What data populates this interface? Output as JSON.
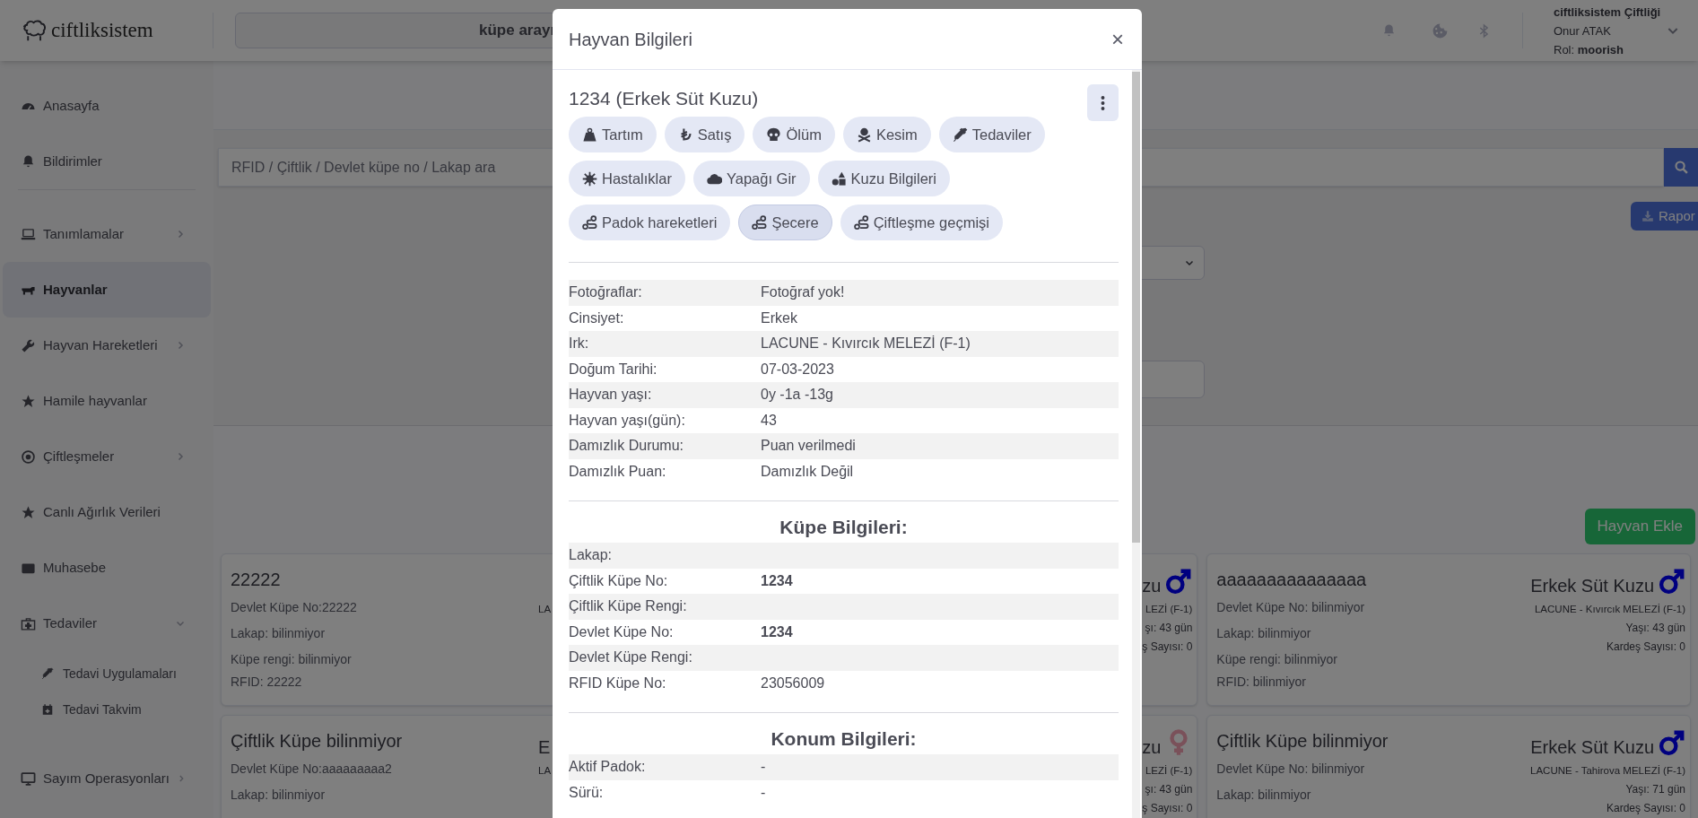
{
  "topbar": {
    "logo": "ciftliksistem",
    "search_button": "küpe arayı",
    "farm": "ciftliksistem Çiftliği",
    "user": "Onur ATAK",
    "role_label": "Rol:",
    "role": "moorish"
  },
  "sidebar": {
    "items": [
      {
        "label": "Anasayfa",
        "kind": "link",
        "selected": false
      },
      {
        "label": "Bildirimler",
        "kind": "link",
        "selected": false
      },
      {
        "label": "Tanımlamalar",
        "kind": "group",
        "selected": false,
        "expanded": false
      },
      {
        "label": "Hayvanlar",
        "kind": "link",
        "selected": true
      },
      {
        "label": "Hayvan Hareketleri",
        "kind": "group",
        "selected": false,
        "expanded": false
      },
      {
        "label": "Hamile hayvanlar",
        "kind": "link",
        "selected": false
      },
      {
        "label": "Çiftleşmeler",
        "kind": "group",
        "selected": false,
        "expanded": false
      },
      {
        "label": "Canlı Ağırlık Verileri",
        "kind": "link",
        "selected": false
      },
      {
        "label": "Muhasebe",
        "kind": "link",
        "selected": false
      },
      {
        "label": "Tedaviler",
        "kind": "group",
        "selected": false,
        "expanded": true,
        "children": [
          {
            "label": "Tedavi Uygulamaları",
            "selected": false
          },
          {
            "label": "Tedavi Takvim",
            "selected": false
          }
        ]
      },
      {
        "label": "Sayım Operasyonları",
        "kind": "group",
        "selected": false,
        "expanded": false
      }
    ]
  },
  "main": {
    "search": {
      "placeholder": "RFID / Çiftlik / Devlet küpe no / Lakap ara"
    },
    "report_button": "Rapor",
    "add_button": "Hayvan Ekle",
    "cards": [
      {
        "title": "22222",
        "details": [
          "Devlet Küpe No:22222",
          "Lakap: bilinmiyor",
          "Küpe rengi: bilinmiyor",
          "RFID: 22222"
        ],
        "breed": "LA"
      },
      {
        "type": "zu",
        "kind": "male",
        "breed": "LEZİ (F-1)",
        "age": "şı: 43 gün",
        "siblings": "ş Sayısı: 0"
      },
      {
        "title": "aaaaaaaaaaaaaaa",
        "details": [
          "Devlet Küpe No: bilinmiyor",
          "Lakap: bilinmiyor",
          "Küpe rengi: bilinmiyor",
          "RFID: bilinmiyor"
        ],
        "type": "Erkek Süt Kuzu",
        "kind": "male",
        "breed": "LACUNE - Kıvırcık MELEZİ (F-1)",
        "age": "Yaşı: 43 gün",
        "siblings": "Kardeş Sayısı: 0"
      },
      {
        "title": "Çiftlik Küpe bilinmiyor",
        "details": [
          "Devlet Küpe No:aaaaaaaaa2",
          "Lakap: bilinmiyor"
        ],
        "type": "E",
        "breed": "LA"
      },
      {
        "type": "zu",
        "kind": "female",
        "breed": "LEZİ (F-1)",
        "age": "şı: 43 gün",
        "siblings": "ş Sayısı: 0"
      },
      {
        "title": "Çiftlik Küpe bilinmiyor",
        "details": [
          "Devlet Küpe No: bilinmiyor",
          "Lakap: bilinmiyor"
        ],
        "type": "Erkek Süt Kuzu",
        "kind": "male",
        "breed": "LACUNE - Tahirova MELEZİ (F-1)",
        "age": "Yaşı: 71 gün",
        "siblings": "Kardeş Sayısı: 0"
      }
    ]
  },
  "modal": {
    "title": "Hayvan Bilgileri",
    "close": "×",
    "heading": "1234 (Erkek Süt Kuzu)",
    "actions": [
      {
        "label": "Tartım",
        "selected": false
      },
      {
        "label": "Satış",
        "selected": false
      },
      {
        "label": "Ölüm",
        "selected": false
      },
      {
        "label": "Kesim",
        "selected": false
      },
      {
        "label": "Tedaviler",
        "selected": false
      },
      {
        "label": "Hastalıklar",
        "selected": false
      },
      {
        "label": "Yapağı Gir",
        "selected": false
      },
      {
        "label": "Kuzu Bilgileri",
        "selected": false
      },
      {
        "label": "Padok hareketleri",
        "selected": false
      },
      {
        "label": "Şecere",
        "selected": true
      },
      {
        "label": "Çiftleşme geçmişi",
        "selected": false
      }
    ],
    "sections": [
      {
        "rows": [
          {
            "label": "Fotoğraflar:",
            "value": "Fotoğraf yok!"
          },
          {
            "label": "Cinsiyet:",
            "value": "Erkek"
          },
          {
            "label": "Irk:",
            "value": "LACUNE - Kıvırcık MELEZİ (F-1)"
          },
          {
            "label": "Doğum Tarihi:",
            "value": "07-03-2023"
          },
          {
            "label": "Hayvan yaşı:",
            "value": "0y -1a -13g"
          },
          {
            "label": "Hayvan yaşı(gün):",
            "value": "43"
          },
          {
            "label": "Damızlık Durumu:",
            "value": "Puan verilmedi"
          },
          {
            "label": "Damızlık Puan:",
            "value": "Damızlık Değil"
          }
        ]
      },
      {
        "title": "Küpe Bilgileri:",
        "rows": [
          {
            "label": "Lakap:"
          },
          {
            "label": "Çiftlik Küpe No:",
            "value": "1234",
            "bold": true
          },
          {
            "label": "Çiftlik Küpe Rengi:"
          },
          {
            "label": "Devlet Küpe No:",
            "value": "1234",
            "bold": true
          },
          {
            "label": "Devlet Küpe Rengi:"
          },
          {
            "label": "RFID Küpe No:",
            "value": "23056009",
            "bold": false
          }
        ]
      },
      {
        "title": "Konum Bilgileri:",
        "rows": [
          {
            "label": "Aktif Padok:",
            "value": "-"
          },
          {
            "label": "Sürü:",
            "value": "-"
          }
        ]
      }
    ]
  }
}
